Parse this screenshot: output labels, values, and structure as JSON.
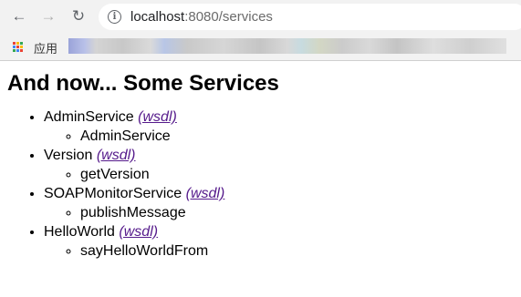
{
  "browser": {
    "url_host": "localhost",
    "url_rest": ":8080/services",
    "bookmarks_label": "应用"
  },
  "page": {
    "heading": "And now... Some Services",
    "services": [
      {
        "name": "AdminService",
        "link": "(wsdl)",
        "operations": [
          "AdminService"
        ]
      },
      {
        "name": "Version",
        "link": "(wsdl)",
        "operations": [
          "getVersion"
        ]
      },
      {
        "name": "SOAPMonitorService",
        "link": "(wsdl)",
        "operations": [
          "publishMessage"
        ]
      },
      {
        "name": "HelloWorld",
        "link": "(wsdl)",
        "operations": [
          "sayHelloWorldFrom"
        ]
      }
    ]
  },
  "colors": {
    "toolbar_bg": "#f2f2f2",
    "visited_link": "#551a8b"
  }
}
